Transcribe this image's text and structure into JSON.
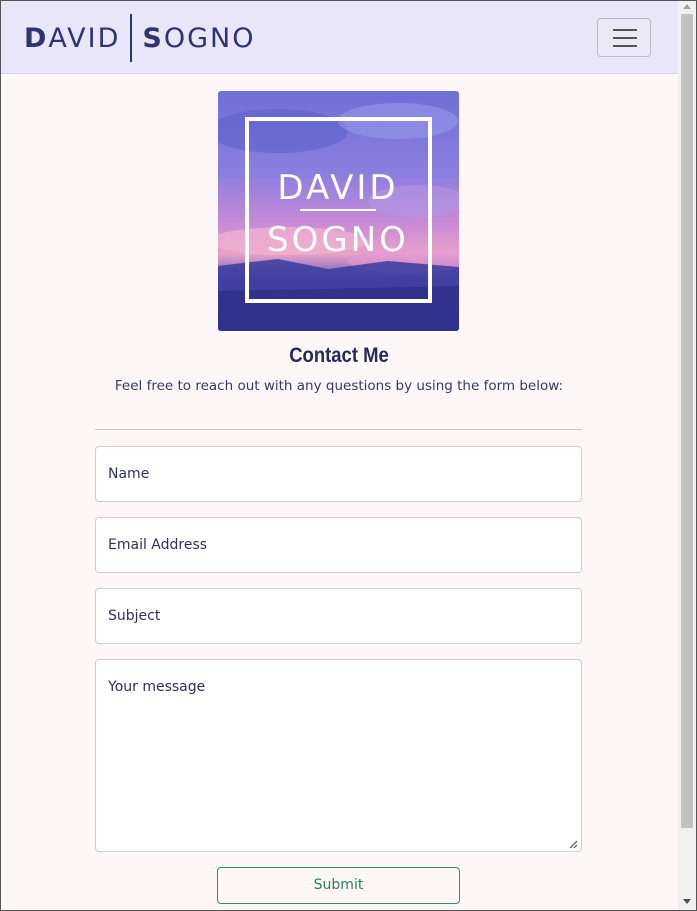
{
  "navbar": {
    "brand_first": "DAVID",
    "brand_last": "SOGNO"
  },
  "logo": {
    "line1": "DAVID",
    "line2": "SOGNO"
  },
  "contact": {
    "title": "Contact Me",
    "subtitle": "Feel free to reach out with any questions by using the form below:"
  },
  "form": {
    "name_placeholder": "Name",
    "email_placeholder": "Email Address",
    "subject_placeholder": "Subject",
    "message_placeholder": "Your message",
    "submit_label": "Submit"
  },
  "icons": {
    "menu": "hamburger-menu-icon",
    "resize": "resize-grip-icon"
  },
  "colors": {
    "navbar_bg": "#e8e6f8",
    "brand": "#2e3470",
    "page_bg": "#fdf8f7",
    "submit_accent": "#2f8f66"
  }
}
